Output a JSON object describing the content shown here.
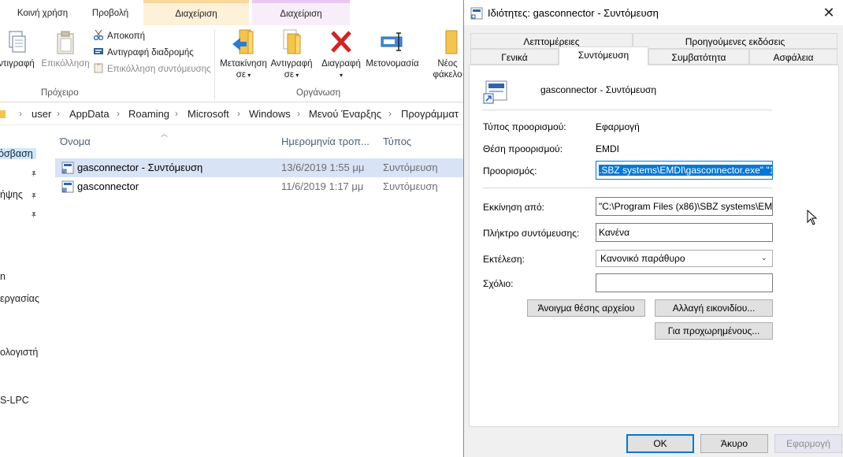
{
  "explorer": {
    "tabs": [
      {
        "label": "Κοινή χρήση"
      },
      {
        "label": "Προβολή"
      },
      {
        "label": "Διαχείριση"
      },
      {
        "label": "Διαχείριση"
      }
    ],
    "ribbon": {
      "copy_label": "ντιγραφή",
      "paste_label": "Επικόλληση",
      "cut_label": "Αποκοπή",
      "copy_path_label": "Αντιγραφή διαδρομής",
      "paste_shortcut_label": "Επικόλληση συντόμευσης",
      "move_to_label": "Μετακίνηση",
      "move_to_label2": "σε",
      "copy_to_label": "Αντιγραφή",
      "copy_to_label2": "σε",
      "delete_label": "Διαγραφή",
      "rename_label": "Μετονομασία",
      "new_folder_label": "Νέος",
      "new_folder_label2": "φάκελο",
      "group_clipboard": "Πρόχειρο",
      "group_organize": "Οργάνωση"
    },
    "breadcrumb": [
      "user",
      "AppData",
      "Roaming",
      "Microsoft",
      "Windows",
      "Μενού Έναρξης",
      "Προγράμματ"
    ],
    "nav": [
      {
        "label": "όσβαση"
      },
      {
        "label": "ήψης"
      },
      {
        "label": "n"
      },
      {
        "label": "εργασίας"
      },
      {
        "label": "ολογιστή"
      },
      {
        "label": "S-LPC"
      }
    ],
    "columns": {
      "name": "Όνομα",
      "date": "Ημερομηνία τροπ...",
      "type": "Τύπος"
    },
    "files": [
      {
        "name": "gasconnector - Συντόμευση",
        "date": "13/6/2019 1:55 μμ",
        "type": "Συντόμευση",
        "selected": true
      },
      {
        "name": "gasconnector",
        "date": "11/6/2019 1:17 μμ",
        "type": "Συντόμευση",
        "selected": false
      }
    ]
  },
  "dialog": {
    "title": "Ιδιότητες: gasconnector - Συντόμευση",
    "tabs_row1": [
      {
        "label": "Λεπτομέρειες"
      },
      {
        "label": "Προηγούμενες εκδόσεις"
      }
    ],
    "tabs_row2": [
      {
        "label": "Γενικά"
      },
      {
        "label": "Συντόμευση"
      },
      {
        "label": "Συμβατότητα"
      },
      {
        "label": "Ασφάλεια"
      }
    ],
    "shortcut_name": "gasconnector - Συντόμευση",
    "target_type_label": "Τύπος προορισμού:",
    "target_type_value": "Εφαρμογή",
    "target_location_label": "Θέση προορισμού:",
    "target_location_value": "EMDI",
    "target_label": "Προορισμός:",
    "target_value": ".SBZ systems\\EMDI\\gasconnector.exe\" \"1\"",
    "start_in_label": "Εκκίνηση από:",
    "start_in_value": "\"C:\\Program Files (x86)\\SBZ systems\\EMD",
    "hotkey_label": "Πλήκτρο συντόμευσης:",
    "hotkey_value": "Κανένα",
    "run_label": "Εκτέλεση:",
    "run_value": "Κανονικό παράθυρο",
    "comment_label": "Σχόλιο:",
    "comment_value": "",
    "open_location_btn": "Άνοιγμα θέσης αρχείου",
    "change_icon_btn": "Αλλαγή εικονιδίου...",
    "advanced_btn": "Για προχωρημένους...",
    "ok_btn": "OK",
    "cancel_btn": "Άκυρο",
    "apply_btn": "Εφαρμογή"
  }
}
